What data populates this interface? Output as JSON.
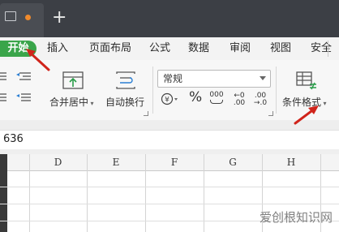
{
  "tabs": {
    "active": "开始",
    "items": [
      "插入",
      "页面布局",
      "公式",
      "数据",
      "审阅",
      "视图",
      "安全"
    ],
    "new_tab_symbol": "+"
  },
  "ribbon": {
    "merge_center": "合并居中",
    "wrap_text": "自动换行",
    "number_format_value": "常规",
    "percent_symbol": "%",
    "thousands": "000",
    "increase_decimal_top": "←0",
    "increase_decimal_bottom": ".00",
    "decrease_decimal_top": ".00",
    "decrease_decimal_bottom": "→.0",
    "conditional_format": "条件格式"
  },
  "formula_bar": {
    "value": "636"
  },
  "columns": [
    "D",
    "E",
    "F",
    "G",
    "H"
  ],
  "watermark": "爱创根知识网",
  "colors": {
    "accent_green": "#3aa54a",
    "arrow_red": "#d0241b",
    "title_bar": "#3c3f45"
  }
}
